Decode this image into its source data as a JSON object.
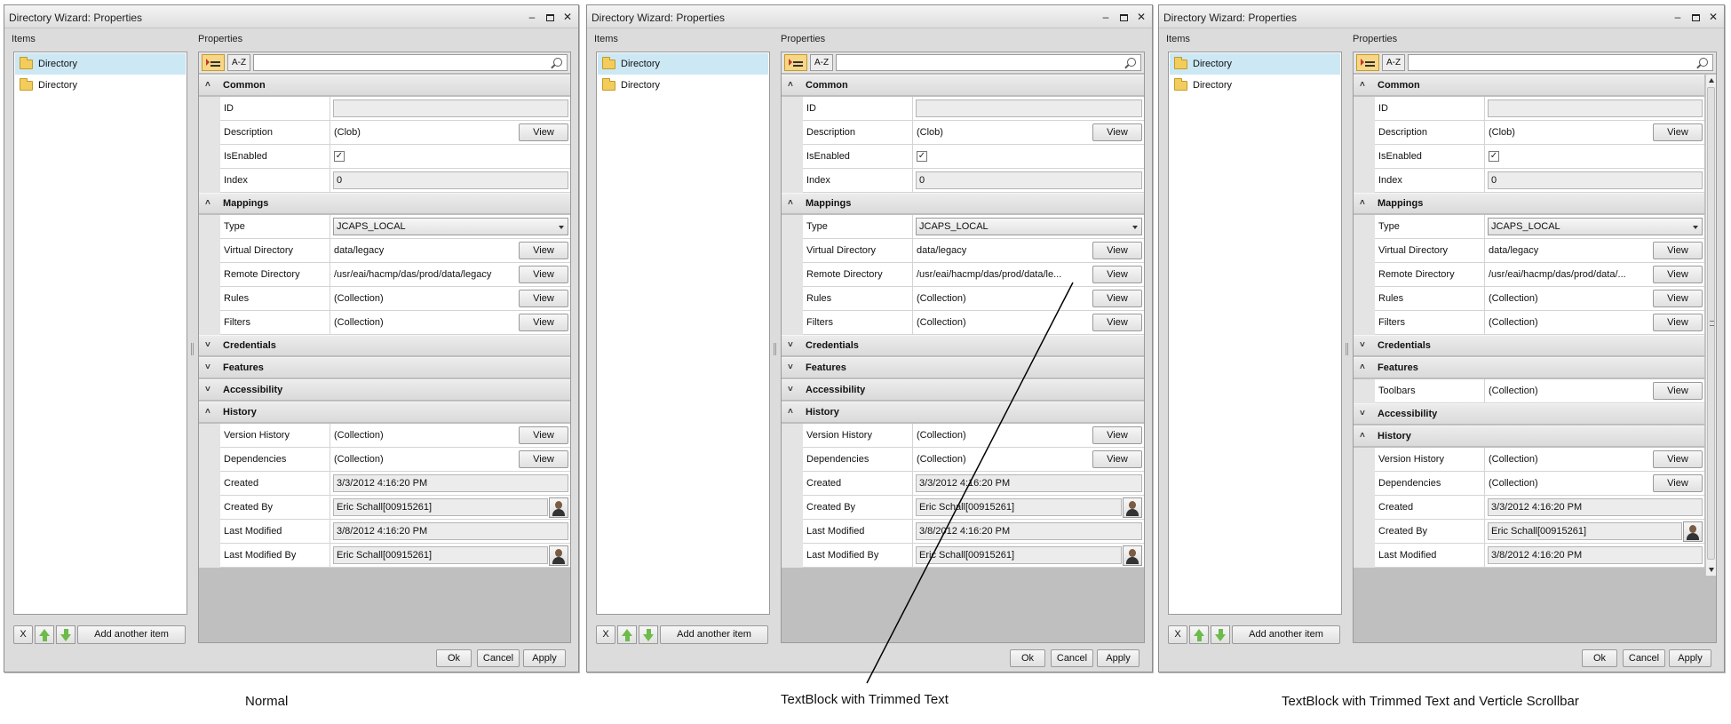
{
  "windows": [
    {
      "title": "Directory Wizard: Properties",
      "items_label": "Items",
      "properties_label": "Properties",
      "items": [
        "Directory",
        "Directory"
      ],
      "toolbar": {
        "sort_az": "A-Z"
      },
      "rows": [
        {
          "kind": "cat",
          "name": "Common",
          "expanded": true
        },
        {
          "kind": "prop",
          "name": "ID",
          "value": "",
          "type": "box"
        },
        {
          "kind": "prop",
          "name": "Description",
          "value": "(Clob)",
          "type": "text",
          "button": "View"
        },
        {
          "kind": "prop",
          "name": "IsEnabled",
          "value": "✓",
          "type": "check"
        },
        {
          "kind": "prop",
          "name": "Index",
          "value": "0",
          "type": "box"
        },
        {
          "kind": "cat",
          "name": "Mappings",
          "expanded": true
        },
        {
          "kind": "prop",
          "name": "Type",
          "value": "JCAPS_LOCAL",
          "type": "combo"
        },
        {
          "kind": "prop",
          "name": "Virtual Directory",
          "value": "data/legacy",
          "type": "text",
          "button": "View"
        },
        {
          "kind": "prop",
          "name": "Remote Directory",
          "value": "/usr/eai/hacmp/das/prod/data/legacy",
          "type": "text",
          "button": "View"
        },
        {
          "kind": "prop",
          "name": "Rules",
          "value": "(Collection)",
          "type": "text",
          "button": "View"
        },
        {
          "kind": "prop",
          "name": "Filters",
          "value": "(Collection)",
          "type": "text",
          "button": "View"
        },
        {
          "kind": "cat",
          "name": "Credentials",
          "expanded": false
        },
        {
          "kind": "cat",
          "name": "Features",
          "expanded": false
        },
        {
          "kind": "cat",
          "name": "Accessibility",
          "expanded": false
        },
        {
          "kind": "cat",
          "name": "History",
          "expanded": true
        },
        {
          "kind": "prop",
          "name": "Version History",
          "value": "(Collection)",
          "type": "text",
          "button": "View"
        },
        {
          "kind": "prop",
          "name": "Dependencies",
          "value": "(Collection)",
          "type": "text",
          "button": "View"
        },
        {
          "kind": "prop",
          "name": "Created",
          "value": "3/3/2012 4:16:20 PM",
          "type": "box"
        },
        {
          "kind": "prop",
          "name": "Created By",
          "value": "Eric Schall[00915261]",
          "type": "user"
        },
        {
          "kind": "prop",
          "name": "Last Modified",
          "value": "3/8/2012 4:16:20 PM",
          "type": "box"
        },
        {
          "kind": "prop",
          "name": "Last Modified By",
          "value": "Eric Schall[00915261]",
          "type": "user"
        }
      ],
      "buttons": {
        "remove": "X",
        "add_item": "Add another item",
        "ok": "Ok",
        "cancel": "Cancel",
        "apply": "Apply"
      },
      "caption": "Normal"
    },
    {
      "title": "Directory Wizard: Properties",
      "items_label": "Items",
      "properties_label": "Properties",
      "items": [
        "Directory",
        "Directory"
      ],
      "toolbar": {
        "sort_az": "A-Z"
      },
      "rows": [
        {
          "kind": "cat",
          "name": "Common",
          "expanded": true
        },
        {
          "kind": "prop",
          "name": "ID",
          "value": "",
          "type": "box"
        },
        {
          "kind": "prop",
          "name": "Description",
          "value": "(Clob)",
          "type": "text",
          "button": "View"
        },
        {
          "kind": "prop",
          "name": "IsEnabled",
          "value": "✓",
          "type": "check"
        },
        {
          "kind": "prop",
          "name": "Index",
          "value": "0",
          "type": "box"
        },
        {
          "kind": "cat",
          "name": "Mappings",
          "expanded": true
        },
        {
          "kind": "prop",
          "name": "Type",
          "value": "JCAPS_LOCAL",
          "type": "combo"
        },
        {
          "kind": "prop",
          "name": "Virtual Directory",
          "value": "data/legacy",
          "type": "text",
          "button": "View"
        },
        {
          "kind": "prop",
          "name": "Remote Directory",
          "value": "/usr/eai/hacmp/das/prod/data/le...",
          "type": "text",
          "button": "View"
        },
        {
          "kind": "prop",
          "name": "Rules",
          "value": "(Collection)",
          "type": "text",
          "button": "View"
        },
        {
          "kind": "prop",
          "name": "Filters",
          "value": "(Collection)",
          "type": "text",
          "button": "View"
        },
        {
          "kind": "cat",
          "name": "Credentials",
          "expanded": false
        },
        {
          "kind": "cat",
          "name": "Features",
          "expanded": false
        },
        {
          "kind": "cat",
          "name": "Accessibility",
          "expanded": false
        },
        {
          "kind": "cat",
          "name": "History",
          "expanded": true
        },
        {
          "kind": "prop",
          "name": "Version History",
          "value": "(Collection)",
          "type": "text",
          "button": "View"
        },
        {
          "kind": "prop",
          "name": "Dependencies",
          "value": "(Collection)",
          "type": "text",
          "button": "View"
        },
        {
          "kind": "prop",
          "name": "Created",
          "value": "3/3/2012 4:16:20 PM",
          "type": "box"
        },
        {
          "kind": "prop",
          "name": "Created By",
          "value": "Eric Schall[00915261]",
          "type": "user"
        },
        {
          "kind": "prop",
          "name": "Last Modified",
          "value": "3/8/2012 4:16:20 PM",
          "type": "box"
        },
        {
          "kind": "prop",
          "name": "Last Modified By",
          "value": "Eric Schall[00915261]",
          "type": "user"
        }
      ],
      "buttons": {
        "remove": "X",
        "add_item": "Add another item",
        "ok": "Ok",
        "cancel": "Cancel",
        "apply": "Apply"
      },
      "caption": "TextBlock with Trimmed Text"
    },
    {
      "title": "Directory Wizard: Properties",
      "items_label": "Items",
      "properties_label": "Properties",
      "items": [
        "Directory",
        "Directory"
      ],
      "toolbar": {
        "sort_az": "A-Z"
      },
      "scrollbar": true,
      "rows": [
        {
          "kind": "cat",
          "name": "Common",
          "expanded": true
        },
        {
          "kind": "prop",
          "name": "ID",
          "value": "",
          "type": "box"
        },
        {
          "kind": "prop",
          "name": "Description",
          "value": "(Clob)",
          "type": "text",
          "button": "View"
        },
        {
          "kind": "prop",
          "name": "IsEnabled",
          "value": "✓",
          "type": "check"
        },
        {
          "kind": "prop",
          "name": "Index",
          "value": "0",
          "type": "box"
        },
        {
          "kind": "cat",
          "name": "Mappings",
          "expanded": true
        },
        {
          "kind": "prop",
          "name": "Type",
          "value": "JCAPS_LOCAL",
          "type": "combo"
        },
        {
          "kind": "prop",
          "name": "Virtual Directory",
          "value": "data/legacy",
          "type": "text",
          "button": "View"
        },
        {
          "kind": "prop",
          "name": "Remote Directory",
          "value": "/usr/eai/hacmp/das/prod/data/...",
          "type": "text",
          "button": "View"
        },
        {
          "kind": "prop",
          "name": "Rules",
          "value": "(Collection)",
          "type": "text",
          "button": "View"
        },
        {
          "kind": "prop",
          "name": "Filters",
          "value": "(Collection)",
          "type": "text",
          "button": "View"
        },
        {
          "kind": "cat",
          "name": "Credentials",
          "expanded": false
        },
        {
          "kind": "cat",
          "name": "Features",
          "expanded": true
        },
        {
          "kind": "prop",
          "name": "Toolbars",
          "value": "(Collection)",
          "type": "text",
          "button": "View"
        },
        {
          "kind": "cat",
          "name": "Accessibility",
          "expanded": false
        },
        {
          "kind": "cat",
          "name": "History",
          "expanded": true
        },
        {
          "kind": "prop",
          "name": "Version History",
          "value": "(Collection)",
          "type": "text",
          "button": "View"
        },
        {
          "kind": "prop",
          "name": "Dependencies",
          "value": "(Collection)",
          "type": "text",
          "button": "View"
        },
        {
          "kind": "prop",
          "name": "Created",
          "value": "3/3/2012 4:16:20 PM",
          "type": "box"
        },
        {
          "kind": "prop",
          "name": "Created By",
          "value": "Eric Schall[00915261]",
          "type": "user"
        },
        {
          "kind": "prop",
          "name": "Last Modified",
          "value": "3/8/2012 4:16:20 PM",
          "type": "box"
        }
      ],
      "buttons": {
        "remove": "X",
        "add_item": "Add another item",
        "ok": "Ok",
        "cancel": "Cancel",
        "apply": "Apply"
      },
      "caption": "TextBlock with Trimmed Text and Verticle Scrollbar"
    }
  ]
}
